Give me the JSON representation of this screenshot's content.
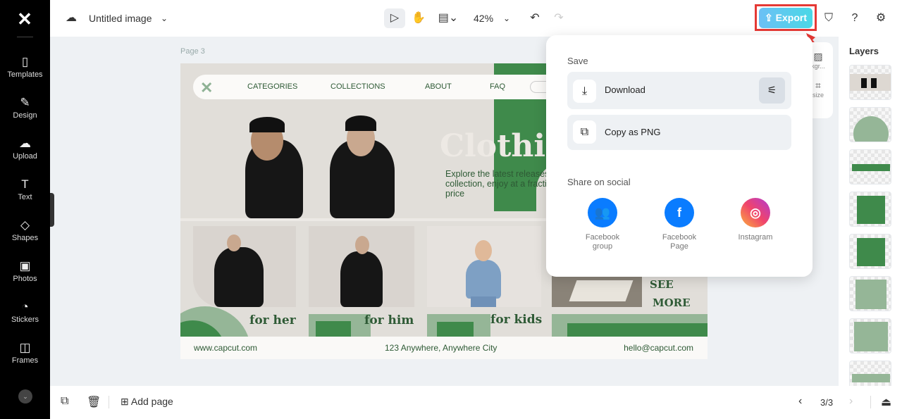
{
  "sidebar": {
    "items": [
      {
        "label": "Templates",
        "icon": "templates-icon"
      },
      {
        "label": "Design",
        "icon": "design-icon"
      },
      {
        "label": "Upload",
        "icon": "upload-icon"
      },
      {
        "label": "Text",
        "icon": "text-icon"
      },
      {
        "label": "Shapes",
        "icon": "shapes-icon"
      },
      {
        "label": "Photos",
        "icon": "photos-icon"
      },
      {
        "label": "Stickers",
        "icon": "stickers-icon"
      },
      {
        "label": "Frames",
        "icon": "frames-icon"
      }
    ]
  },
  "topbar": {
    "title": "Untitled image",
    "zoom": "42%",
    "export_label": "Export",
    "highlight_color": "#e53935"
  },
  "canvas": {
    "page_label": "Page 3",
    "nav": [
      "CATEGORIES",
      "COLLECTIONS",
      "ABOUT",
      "FAQ"
    ],
    "hero": "Clothi",
    "hero_sub": "Explore the latest releases our new collection, enjoy at a fraction of the price",
    "captions": [
      "for her",
      "for him",
      "for kids"
    ],
    "see_more": [
      "SEE",
      "MORE"
    ],
    "footer": {
      "website": "www.capcut.com",
      "address": "123 Anywhere, Anywhere City",
      "email": "hello@capcut.com"
    }
  },
  "export_menu": {
    "save_title": "Save",
    "download": "Download",
    "copy_png": "Copy as PNG",
    "share_title": "Share on social",
    "social": [
      {
        "line1": "Facebook",
        "line2": "group",
        "color": "#0a7cff"
      },
      {
        "line1": "Facebook",
        "line2": "Page",
        "color": "#0a7cff"
      },
      {
        "line1": "Instagram",
        "line2": "",
        "color": "#e1306c"
      }
    ]
  },
  "float_tools": {
    "bg_label": "kgr...",
    "resize_label": "size"
  },
  "layers": {
    "title": "Layers"
  },
  "bottom": {
    "add_page": "Add page",
    "page_indicator": "3/3"
  }
}
